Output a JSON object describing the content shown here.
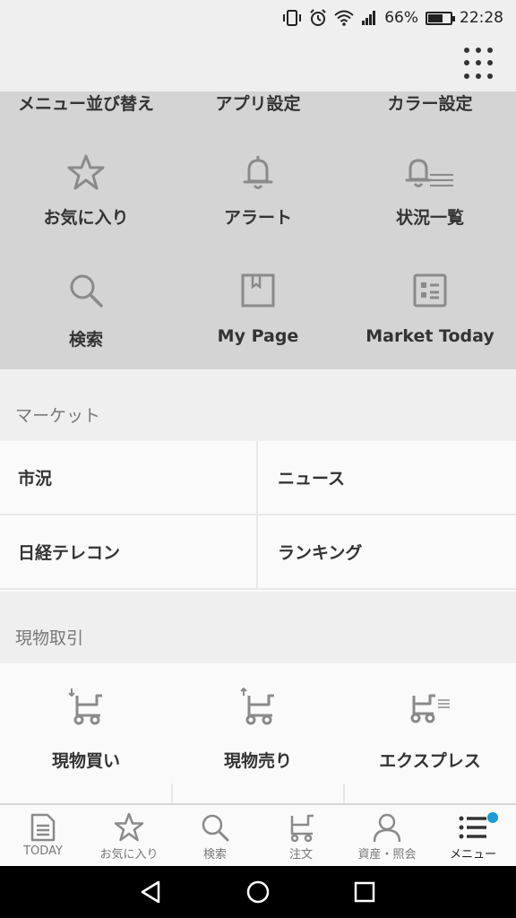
{
  "status_bar": {
    "battery_percent": "66%",
    "battery_level": 0.66,
    "time": "22:28",
    "icons": [
      "vibrate-icon",
      "alarm-icon",
      "wifi-icon",
      "signal-icon",
      "battery-icon"
    ]
  },
  "header": {
    "menu_icon": "grid-menu-icon"
  },
  "settings_panel": {
    "top_links": [
      "メニュー並び替え",
      "アプリ設定",
      "カラー設定"
    ],
    "row1": [
      {
        "label": "お気に入り",
        "icon": "star-icon"
      },
      {
        "label": "アラート",
        "icon": "bell-icon"
      },
      {
        "label": "状況一覧",
        "icon": "bell-list-icon"
      }
    ],
    "row2": [
      {
        "label": "検索",
        "icon": "search-icon"
      },
      {
        "label": "My Page",
        "icon": "bookmark-page-icon"
      },
      {
        "label": "Market Today",
        "icon": "news-icon"
      }
    ]
  },
  "market": {
    "title": "マーケット",
    "items": [
      "市況",
      "ニュース",
      "日経テレコン",
      "ランキング"
    ]
  },
  "spot_trading": {
    "title": "現物取引",
    "items": [
      {
        "label": "現物買い",
        "icon": "cart-buy-icon"
      },
      {
        "label": "現物売り",
        "icon": "cart-sell-icon"
      },
      {
        "label": "エクスプレス",
        "icon": "cart-express-icon"
      }
    ]
  },
  "bottom_nav": [
    {
      "label": "TODAY",
      "icon": "today-document-icon"
    },
    {
      "label": "お気に入り",
      "icon": "star-icon"
    },
    {
      "label": "検索",
      "icon": "search-icon"
    },
    {
      "label": "注文",
      "icon": "cart-icon"
    },
    {
      "label": "資産・照会",
      "icon": "person-icon"
    },
    {
      "label": "メニュー",
      "icon": "menu-list-icon",
      "active": true,
      "has_notification": true
    }
  ],
  "system_nav": [
    "back-icon",
    "home-icon",
    "recents-icon"
  ],
  "colors": {
    "background": "#efefef",
    "panel": "#d4d4d4",
    "card": "#fafafa",
    "icon_gray": "#8a8a8a",
    "notification": "#1a9bd6"
  }
}
